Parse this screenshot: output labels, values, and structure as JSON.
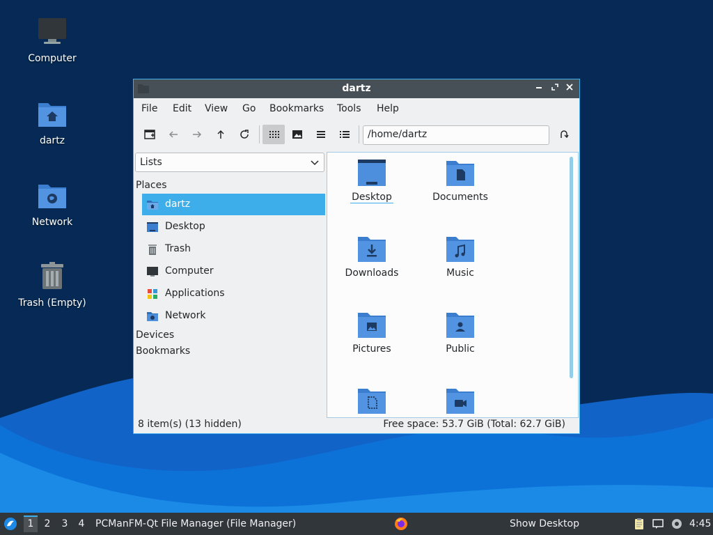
{
  "desktop": {
    "icons": [
      {
        "label": "Computer",
        "icon": "computer-icon"
      },
      {
        "label": "dartz",
        "icon": "home-folder-icon"
      },
      {
        "label": "Network",
        "icon": "network-folder-icon"
      },
      {
        "label": "Trash (Empty)",
        "icon": "trash-icon"
      }
    ]
  },
  "window": {
    "title": "dartz",
    "menu": [
      "File",
      "Edit",
      "View",
      "Go",
      "Bookmarks",
      "Tools",
      "Help"
    ],
    "toolbar": {
      "path": "/home/dartz",
      "buttons": [
        "new-tab-icon",
        "back-icon",
        "forward-icon",
        "up-icon",
        "reload-icon",
        "icon-view-icon",
        "thumbnail-view-icon",
        "compact-view-icon",
        "detailed-list-icon",
        "go-icon"
      ],
      "active_view": "icon-view-icon"
    },
    "side": {
      "mode": "Lists",
      "places_header": "Places",
      "places": [
        {
          "label": "dartz",
          "icon": "home-folder-icon",
          "selected": true
        },
        {
          "label": "Desktop",
          "icon": "desktop-folder-icon"
        },
        {
          "label": "Trash",
          "icon": "trash-icon"
        },
        {
          "label": "Computer",
          "icon": "computer-icon"
        },
        {
          "label": "Applications",
          "icon": "applications-icon"
        },
        {
          "label": "Network",
          "icon": "network-folder-icon"
        }
      ],
      "devices_header": "Devices",
      "bookmarks_header": "Bookmarks"
    },
    "files": [
      {
        "label": "Desktop",
        "icon": "desktop-folder-icon",
        "focused": true
      },
      {
        "label": "Documents",
        "icon": "documents-folder-icon"
      },
      {
        "label": "Downloads",
        "icon": "downloads-folder-icon"
      },
      {
        "label": "Music",
        "icon": "music-folder-icon"
      },
      {
        "label": "Pictures",
        "icon": "pictures-folder-icon"
      },
      {
        "label": "Public",
        "icon": "public-folder-icon"
      },
      {
        "label": "",
        "icon": "templates-folder-icon"
      },
      {
        "label": "",
        "icon": "videos-folder-icon"
      }
    ],
    "status": {
      "left": "8 item(s) (13 hidden)",
      "right": "Free space: 53.7 GiB (Total: 62.7 GiB)"
    }
  },
  "taskbar": {
    "workspaces": [
      "1",
      "2",
      "3",
      "4"
    ],
    "active_workspace": "1",
    "task": "PCManFM-Qt File Manager (File Manager)",
    "show_desktop": "Show Desktop",
    "clock": "4:45",
    "tray": [
      "clipboard-icon",
      "notification-icon",
      "settings-icon"
    ]
  },
  "colors": {
    "accent": "#3daee9",
    "titlebar": "#475057",
    "folder": "#4d8fdc",
    "taskbar": "#31363b",
    "wallpaper": "#062a55"
  }
}
